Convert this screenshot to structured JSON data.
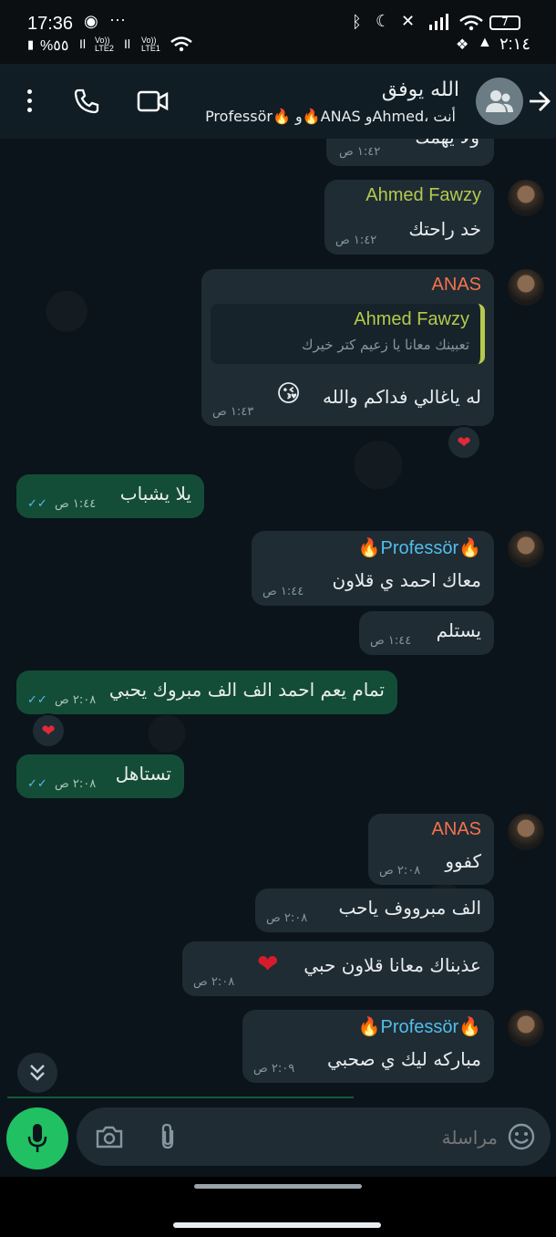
{
  "status_bar": {
    "time": "17:36",
    "battery_percent": "%٥٥",
    "battery_level": "7",
    "clock_right": "٢:١٤",
    "lte1": "Vo)) LTE2",
    "lte2": "Vo)) LTE1"
  },
  "header": {
    "title": "الله يوفق",
    "subtitle": "Professör🔥 و🔥ANAS وAhmed، أنت"
  },
  "messages": [
    {
      "text": "ولا يهمك",
      "time": "١:٤٢ ص"
    },
    {
      "sender": "Ahmed Fawzy",
      "text": "خد راحتك",
      "time": "١:٤٢ ص"
    },
    {
      "sender": "ANAS",
      "quote_sender": "Ahmed Fawzy",
      "quote_text": "تعبينك معانا يا زعيم كتر خيرك",
      "text": "له ياغالي فداكم والله",
      "emoji": "😘",
      "time": "١:٤٣ ص",
      "reaction": "❤"
    },
    {
      "text": "يلا يشباب",
      "time": "١:٤٤ ص",
      "outgoing": true
    },
    {
      "sender": "🔥Professör🔥",
      "text": "معاك احمد ي قلاون",
      "time": "١:٤٤ ص"
    },
    {
      "text": "يستلم",
      "time": "١:٤٤ ص"
    },
    {
      "text": "تمام يعم احمد الف الف مبروك يحبي",
      "time": "٢:٠٨ ص",
      "outgoing": true,
      "reaction": "❤"
    },
    {
      "text": "تستاهل",
      "time": "٢:٠٨ ص",
      "outgoing": true
    },
    {
      "sender": "ANAS",
      "text": "كفوو",
      "time": "٢:٠٨ ص"
    },
    {
      "text": "الف مبرووف ياحب",
      "time": "٢:٠٨ ص"
    },
    {
      "text": "عذبناك معانا قلاون حبي",
      "emoji": "❤",
      "time": "٢:٠٨ ص"
    },
    {
      "sender": "🔥Professör🔥",
      "text": "مباركه ليك ي صحبي",
      "time": "٢:٠٩ ص"
    }
  ],
  "composer": {
    "placeholder": "مراسلة"
  },
  "colors": {
    "accent_green": "#21c063",
    "outgoing_bubble": "#144d37",
    "incoming_bubble": "#1f2c34",
    "ahmed_name": "#b4c94d",
    "anas_name": "#f5724c",
    "professor_name": "#53bdeb",
    "read_ticks": "#53bdeb"
  }
}
